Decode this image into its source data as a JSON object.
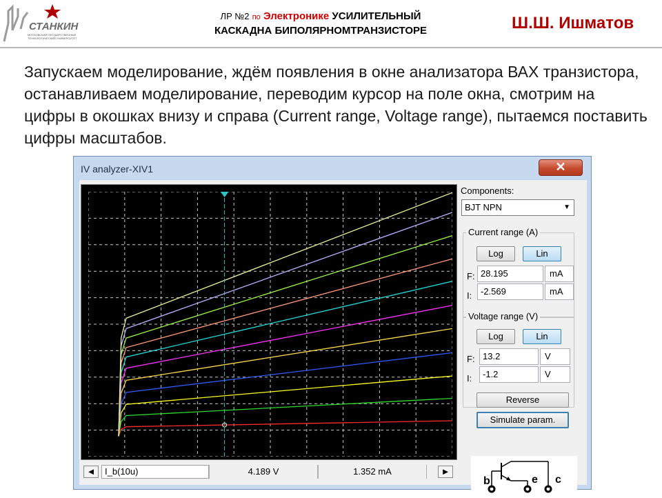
{
  "header": {
    "title_part1": "ЛР №2",
    "title_part2": "по",
    "title_part3": "Электронике",
    "title_part4": "УСИЛИТЕЛЬНЫЙ",
    "title_line2": "КАСКАДНА БИПОЛЯРНОМТРАНЗИСТОРЕ",
    "author": "Ш.Ш. Ишматов",
    "logo_text": "СТАНКИН",
    "logo_subtext": "МОСКОВСКИЙ ГОСУДАРСТВЕННЫЙ ТЕХНОЛОГИЧЕСКИЙ УНИВЕРСИТЕТ"
  },
  "body_text": "Запускаем моделирование, ждём появления в окне анализатора ВАХ транзистора, останавливаем моделирование, переводим курсор на поле окна, смотрим на цифры в окошках внизу и справа (Current range, Voltage range), пытаемся поставить цифры масштабов.",
  "window": {
    "title": "IV analyzer-XIV1",
    "close_symbol": "✕",
    "bottom": {
      "left_arrow": "◄",
      "right_arrow": "►",
      "trace_label": "I_b(10u)",
      "voltage_readout": "4.189  V",
      "current_readout": "1.352 mA"
    },
    "panel": {
      "components_label": "Components:",
      "component_value": "BJT NPN",
      "current_range": {
        "title": "Current range (A)",
        "log": "Log",
        "lin": "Lin",
        "f_label": "F:",
        "f_value": "28.195",
        "f_unit": "mA",
        "i_label": "I:",
        "i_value": "-2.569",
        "i_unit": "mA"
      },
      "voltage_range": {
        "title": "Voltage range (V)",
        "log": "Log",
        "lin": "Lin",
        "f_label": "F:",
        "f_value": "13.2",
        "f_unit": "V",
        "i_label": "I:",
        "i_value": "-1.2",
        "i_unit": "V"
      },
      "reverse_button": "Reverse",
      "simulate_button": "Simulate param.",
      "pins": {
        "b": "b",
        "e": "e",
        "c": "c"
      }
    }
  },
  "colors": {
    "header_author": "#b00000",
    "scope_background": "#000000",
    "grid": "#c8c8c8",
    "cursor": "#2ec4c4",
    "window_frame": "#c7d9ee",
    "close_button": "#c54a2e"
  },
  "chart_data": {
    "type": "line",
    "title": "",
    "xlabel": "",
    "ylabel": "",
    "xlim": [
      -1.2,
      13.2
    ],
    "ylim": [
      -2.569,
      28.195
    ],
    "grid": true,
    "cursor_x": 4.189,
    "series": [
      {
        "color": "#ff2a2a",
        "x": [
          0,
          0.1,
          0.3,
          13.2
        ],
        "y": [
          -0.2,
          0.6,
          0.9,
          1.6
        ]
      },
      {
        "color": "#2ddc2d",
        "x": [
          0,
          0.1,
          0.3,
          13.2
        ],
        "y": [
          -0.2,
          1.5,
          2.2,
          4.2
        ]
      },
      {
        "color": "#ffff20",
        "x": [
          0,
          0.1,
          0.3,
          13.2
        ],
        "y": [
          -0.2,
          2.5,
          3.5,
          6.8
        ]
      },
      {
        "color": "#2f5bff",
        "x": [
          0,
          0.1,
          0.3,
          13.2
        ],
        "y": [
          -0.2,
          3.6,
          4.9,
          9.5
        ]
      },
      {
        "color": "#ffd84a",
        "x": [
          0,
          0.1,
          0.3,
          13.2
        ],
        "y": [
          -0.2,
          4.8,
          6.3,
          12.3
        ]
      },
      {
        "color": "#ff30ff",
        "x": [
          0,
          0.1,
          0.3,
          13.2
        ],
        "y": [
          -0.2,
          6.0,
          7.7,
          15.0
        ]
      },
      {
        "color": "#20dcdc",
        "x": [
          0,
          0.1,
          0.3,
          13.2
        ],
        "y": [
          -0.2,
          7.2,
          9.0,
          17.8
        ]
      },
      {
        "color": "#ff9a7a",
        "x": [
          0,
          0.1,
          0.3,
          13.2
        ],
        "y": [
          -0.2,
          8.3,
          10.1,
          20.4
        ]
      },
      {
        "color": "#a0ff4a",
        "x": [
          0,
          0.1,
          0.3,
          13.2
        ],
        "y": [
          -0.2,
          9.3,
          11.2,
          23.1
        ]
      },
      {
        "color": "#b4b4ff",
        "x": [
          0,
          0.1,
          0.3,
          13.2
        ],
        "y": [
          -0.2,
          10.3,
          12.3,
          25.8
        ]
      },
      {
        "color": "#f0f09a",
        "x": [
          0,
          0.1,
          0.3,
          13.2
        ],
        "y": [
          -0.2,
          11.2,
          13.5,
          28.1
        ]
      }
    ]
  }
}
